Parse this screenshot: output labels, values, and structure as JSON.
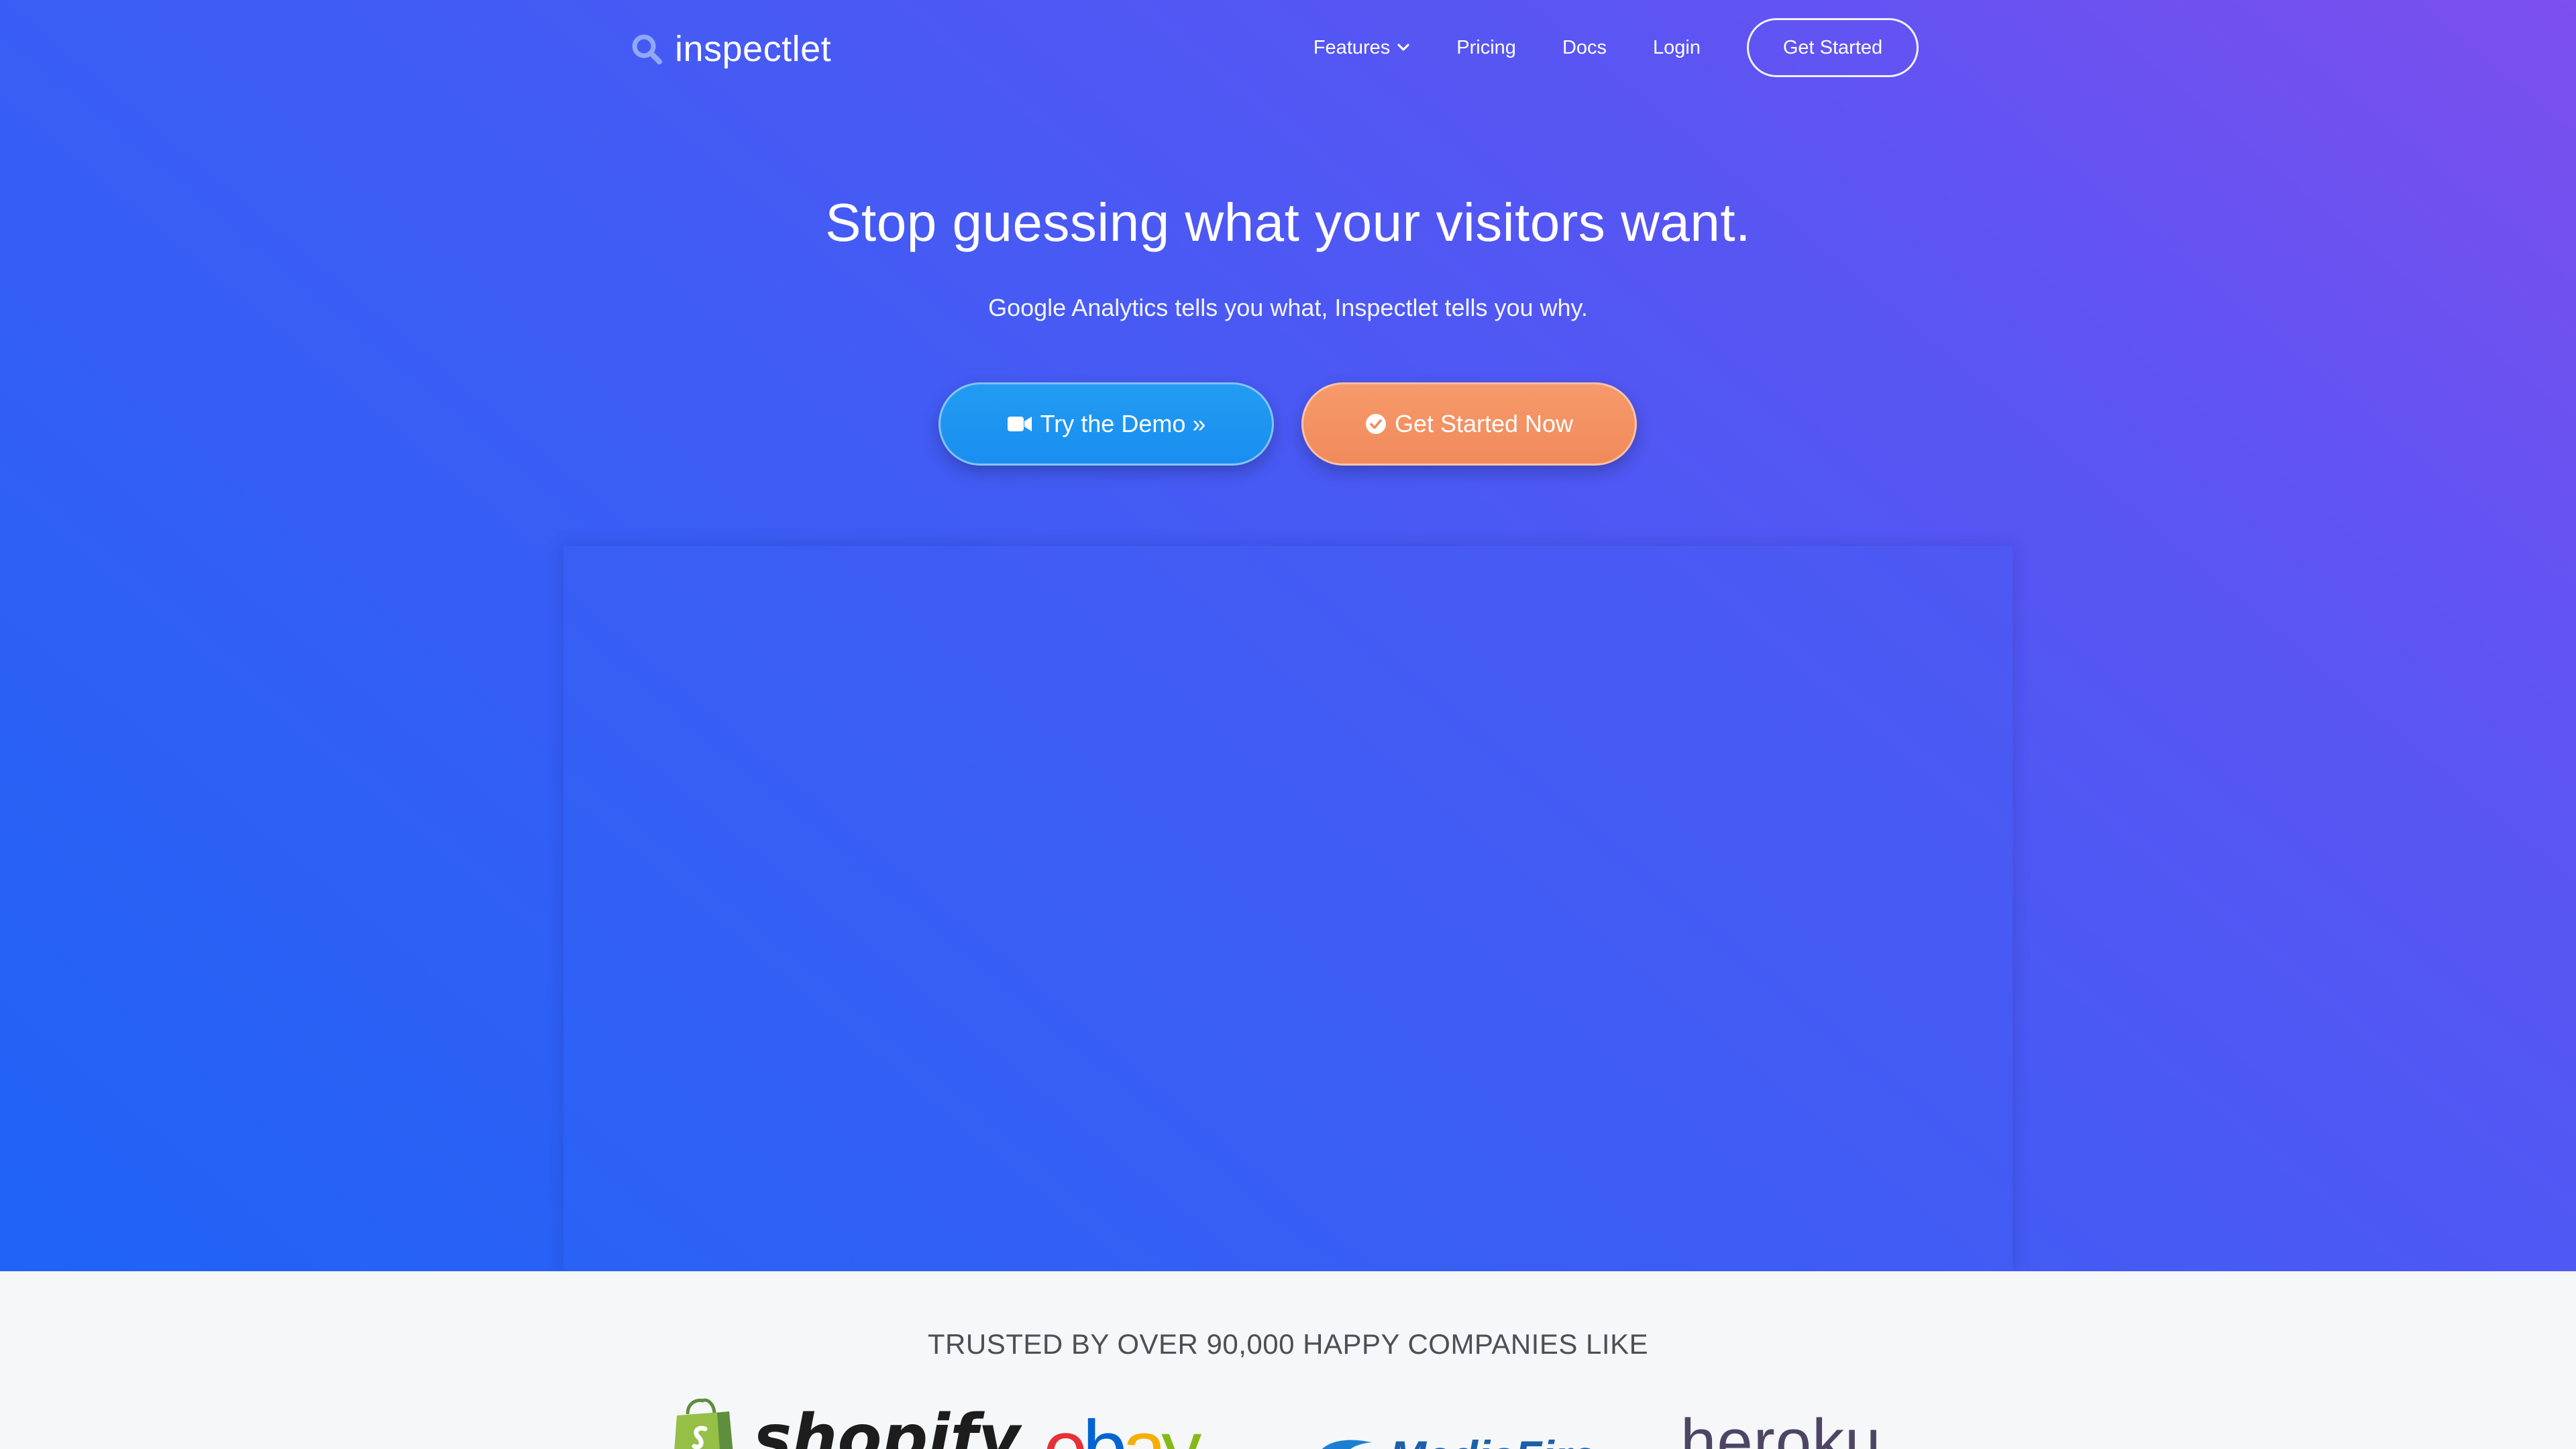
{
  "brand": {
    "name": "inspectlet",
    "icon": "search-icon"
  },
  "nav": {
    "items": [
      {
        "label": "Features",
        "icon": "chevron-down-icon"
      },
      {
        "label": "Pricing"
      },
      {
        "label": "Docs"
      },
      {
        "label": "Login"
      }
    ],
    "cta": "Get Started"
  },
  "hero": {
    "headline": "Stop guessing what your visitors want.",
    "subheadline": "Google Analytics tells you what, Inspectlet tells you why.",
    "demo_button": {
      "label": "Try the Demo »",
      "icon": "video-camera-icon"
    },
    "start_button": {
      "label": "Get Started Now",
      "icon": "check-circle-icon"
    }
  },
  "trusted": {
    "title": "TRUSTED BY OVER 90,000 HAPPY COMPANIES LIKE",
    "logos": [
      {
        "name": "shopify",
        "icon": "shopify-bag-icon"
      },
      {
        "name": "ebay",
        "letters": [
          "e",
          "b",
          "a",
          "y"
        ]
      },
      {
        "name": "MediaFire",
        "icon": "mediafire-flame-icon"
      },
      {
        "name": "heroku"
      }
    ]
  },
  "colors": {
    "gradient_start": "#1f63f6",
    "gradient_end": "#7c4fee",
    "demo_button": "#1a8ef0",
    "start_button": "#f08a5b",
    "ebay_e": "#e53238",
    "ebay_b": "#0064d2",
    "ebay_a": "#f5af02",
    "ebay_y": "#86b817"
  }
}
